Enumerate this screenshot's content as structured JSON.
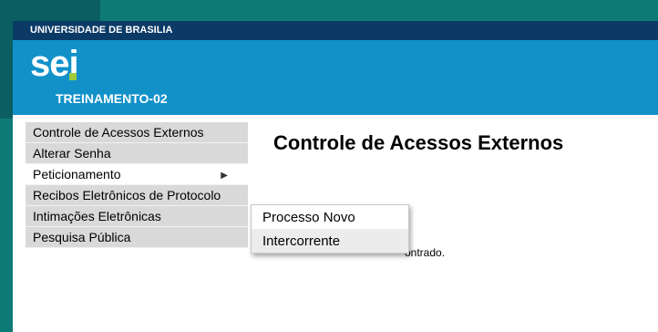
{
  "institution": "UNIVERSIDADE DE BRASILIA",
  "logo_text": "sei",
  "unit": "TREINAMENTO-02",
  "sidebar": {
    "items": [
      {
        "label": "Controle de Acessos Externos"
      },
      {
        "label": "Alterar Senha"
      },
      {
        "label": "Peticionamento"
      },
      {
        "label": "Recibos Eletrônicos de Protocolo"
      },
      {
        "label": "Intimações Eletrônicas"
      },
      {
        "label": "Pesquisa Pública"
      }
    ]
  },
  "main": {
    "title": "Controle de Acessos Externos",
    "partial_text": "ontrado."
  },
  "submenu": {
    "items": [
      {
        "label": "Processo Novo"
      },
      {
        "label": "Intercorrente"
      }
    ]
  },
  "colors": {
    "topbar": "#0b3a66",
    "header": "#1291c9",
    "sidebar": "#d9d9d9",
    "logo_dot": "#9ccc3c"
  }
}
